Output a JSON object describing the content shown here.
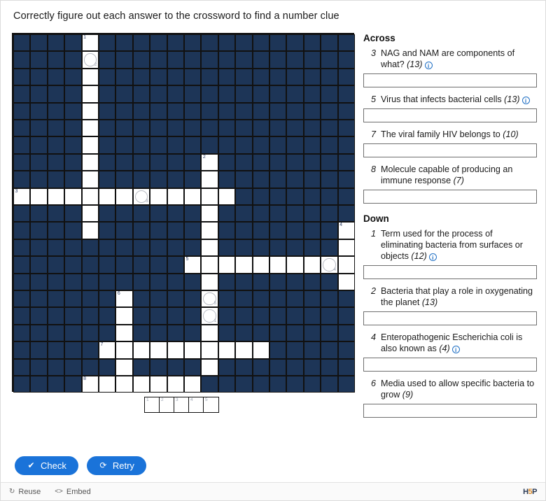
{
  "task": {
    "description": "Correctly figure out each answer to the crossword to find a number clue"
  },
  "grid": {
    "columns": 20,
    "rows": 21,
    "cell_size": 24.4,
    "background_color": "#1d3557",
    "open_color": "#ffffff",
    "border_color": "#111111",
    "cells": [
      {
        "r": 0,
        "c": 4,
        "num": "1"
      },
      {
        "r": 1,
        "c": 4,
        "circle": true,
        "sol": "2"
      },
      {
        "r": 2,
        "c": 4
      },
      {
        "r": 3,
        "c": 4
      },
      {
        "r": 4,
        "c": 4
      },
      {
        "r": 5,
        "c": 4
      },
      {
        "r": 6,
        "c": 4
      },
      {
        "r": 7,
        "c": 4
      },
      {
        "r": 8,
        "c": 4
      },
      {
        "r": 7,
        "c": 11,
        "num": "2"
      },
      {
        "r": 8,
        "c": 11
      },
      {
        "r": 9,
        "c": 0,
        "num": "3"
      },
      {
        "r": 9,
        "c": 1
      },
      {
        "r": 9,
        "c": 2
      },
      {
        "r": 9,
        "c": 3
      },
      {
        "r": 9,
        "c": 4
      },
      {
        "r": 9,
        "c": 5
      },
      {
        "r": 9,
        "c": 6
      },
      {
        "r": 9,
        "c": 7,
        "circle": true,
        "sol": "3"
      },
      {
        "r": 9,
        "c": 8
      },
      {
        "r": 9,
        "c": 9
      },
      {
        "r": 9,
        "c": 10
      },
      {
        "r": 9,
        "c": 11
      },
      {
        "r": 9,
        "c": 12
      },
      {
        "r": 10,
        "c": 4
      },
      {
        "r": 10,
        "c": 11
      },
      {
        "r": 11,
        "c": 4
      },
      {
        "r": 11,
        "c": 11
      },
      {
        "r": 11,
        "c": 19,
        "num": "4"
      },
      {
        "r": 12,
        "c": 11
      },
      {
        "r": 12,
        "c": 19
      },
      {
        "r": 13,
        "c": 10,
        "num": "5"
      },
      {
        "r": 13,
        "c": 11
      },
      {
        "r": 13,
        "c": 12
      },
      {
        "r": 13,
        "c": 13
      },
      {
        "r": 13,
        "c": 14
      },
      {
        "r": 13,
        "c": 15
      },
      {
        "r": 13,
        "c": 16
      },
      {
        "r": 13,
        "c": 17
      },
      {
        "r": 13,
        "c": 18,
        "circle": true,
        "sol": "4"
      },
      {
        "r": 13,
        "c": 19
      },
      {
        "r": 14,
        "c": 11
      },
      {
        "r": 14,
        "c": 19
      },
      {
        "r": 15,
        "c": 6,
        "num": "6"
      },
      {
        "r": 15,
        "c": 11,
        "circle": true,
        "sol": "5"
      },
      {
        "r": 16,
        "c": 6
      },
      {
        "r": 16,
        "c": 11,
        "circle": true,
        "sol": "1"
      },
      {
        "r": 17,
        "c": 6
      },
      {
        "r": 17,
        "c": 11
      },
      {
        "r": 18,
        "c": 5,
        "num": "7"
      },
      {
        "r": 18,
        "c": 6
      },
      {
        "r": 18,
        "c": 7
      },
      {
        "r": 18,
        "c": 8
      },
      {
        "r": 18,
        "c": 9
      },
      {
        "r": 18,
        "c": 10
      },
      {
        "r": 18,
        "c": 11
      },
      {
        "r": 18,
        "c": 12
      },
      {
        "r": 18,
        "c": 13
      },
      {
        "r": 18,
        "c": 14
      },
      {
        "r": 19,
        "c": 6
      },
      {
        "r": 19,
        "c": 11
      },
      {
        "r": 20,
        "c": 4,
        "num": "8"
      },
      {
        "r": 20,
        "c": 5
      },
      {
        "r": 20,
        "c": 6
      },
      {
        "r": 20,
        "c": 7
      },
      {
        "r": 20,
        "c": 8
      },
      {
        "r": 20,
        "c": 9
      },
      {
        "r": 20,
        "c": 10
      }
    ],
    "extra_cells": [
      {
        "r": 21,
        "c": 6
      },
      {
        "r": 22,
        "c": 6
      },
      {
        "r": 23,
        "c": 6
      }
    ]
  },
  "solution_row": {
    "cells": [
      {
        "num": "1"
      },
      {
        "num": "2"
      },
      {
        "num": "3"
      },
      {
        "num": "4"
      },
      {
        "num": "5"
      }
    ]
  },
  "clues": {
    "across_heading": "Across",
    "down_heading": "Down",
    "across": [
      {
        "num": "3",
        "text": "NAG and NAM are components of what?",
        "length": "(13)",
        "has_info": true,
        "dashes": 13,
        "value": "",
        "placeholder": ""
      },
      {
        "num": "5",
        "text": "Virus that infects bacterial cells",
        "length": "(13)",
        "has_info": true,
        "dashes": 13,
        "value": "",
        "placeholder": ""
      },
      {
        "num": "7",
        "text": "The viral family HIV belongs to",
        "length": "(10)",
        "has_info": false,
        "dashes": 10,
        "value": "",
        "placeholder": ""
      },
      {
        "num": "8",
        "text": "Molecule capable of producing an immune response",
        "length": "(7)",
        "has_info": false,
        "dashes": 7,
        "value": "",
        "placeholder": ""
      }
    ],
    "down": [
      {
        "num": "1",
        "text": "Term used for the process of eliminating bacteria from surfaces or objects",
        "length": "(12)",
        "has_info": true,
        "dashes": 14,
        "value": "",
        "placeholder": ""
      },
      {
        "num": "2",
        "text": "Bacteria that play a role in oxygenating the planet",
        "length": "(13)",
        "has_info": false,
        "dashes": 13,
        "value": "",
        "placeholder": ""
      },
      {
        "num": "4",
        "text": "Enteropathogenic Escherichia coli is also known as",
        "length": "(4)",
        "has_info": true,
        "dashes": 4,
        "value": "",
        "placeholder": ""
      },
      {
        "num": "6",
        "text": "Media used to allow specific bacteria to grow",
        "length": "(9)",
        "has_info": false,
        "dashes": 9,
        "value": "",
        "placeholder": ""
      }
    ],
    "info_icon": "i"
  },
  "buttons": {
    "check": {
      "label": "Check",
      "icon": "✔",
      "icon_name": "check-circle-icon"
    },
    "retry": {
      "label": "Retry",
      "icon": "⟳",
      "icon_name": "refresh-icon"
    },
    "accent_color": "#1a73d9"
  },
  "footer": {
    "reuse": {
      "label": "Reuse",
      "icon": "↻"
    },
    "embed": {
      "label": "Embed",
      "icon": "<>"
    },
    "logo": {
      "prefix": "H",
      "mid": "5",
      "suffix": "P"
    }
  }
}
